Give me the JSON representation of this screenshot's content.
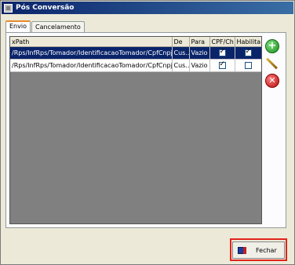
{
  "window": {
    "title": "Pós Conversão"
  },
  "tabs": [
    {
      "label": "Envio"
    },
    {
      "label": "Cancelamento"
    }
  ],
  "grid": {
    "columns": [
      "xPath",
      "De",
      "Para",
      "CPF/Ch",
      "Habilita"
    ],
    "rows": [
      {
        "xpath": "/Rps/InfRps/Tomador/IdentificacaoTomador/CpfCnpj/Cnpj",
        "de": "Cus...",
        "para": "Vazio",
        "cpf": true,
        "habilita": true
      },
      {
        "xpath": "/Rps/InfRps/Tomador/IdentificacaoTomador/CpfCnpj/Cpf",
        "de": "Cus...",
        "para": "Vazio",
        "cpf": true,
        "habilita": false
      }
    ]
  },
  "side_buttons": {
    "add": "add-icon",
    "edit": "pencil-icon",
    "delete": "delete-icon"
  },
  "footer": {
    "close_label": "Fechar"
  }
}
